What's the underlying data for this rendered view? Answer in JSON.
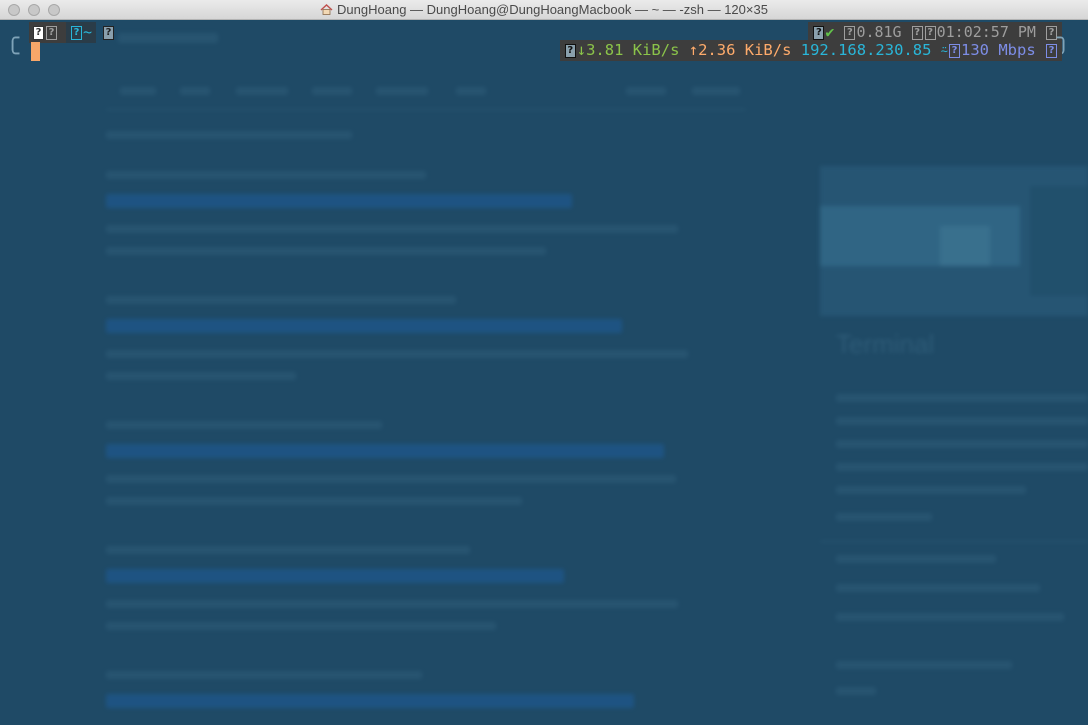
{
  "window": {
    "title": "DungHoang — DungHoang@DungHoangMacbook — ~ — -zsh — 120×35"
  },
  "prompt": {
    "left_glyph": "?",
    "dir": "~",
    "status_ok": "✔",
    "memory": "0.81G",
    "time": "01:02:57 PM",
    "download": "↓3.81 KiB/s",
    "upload": "↑2.36 KiB/s",
    "ip": "192.168.230.85",
    "link_speed": "130 Mbps"
  },
  "colors": {
    "terminal_bg": "#1f4a66",
    "segment_bg": "#3d3d3d",
    "download": "#8bc34a",
    "upload": "#ffab6b",
    "ip": "#29b6d9",
    "link": "#7d8de6",
    "cursor": "#f7a769"
  }
}
